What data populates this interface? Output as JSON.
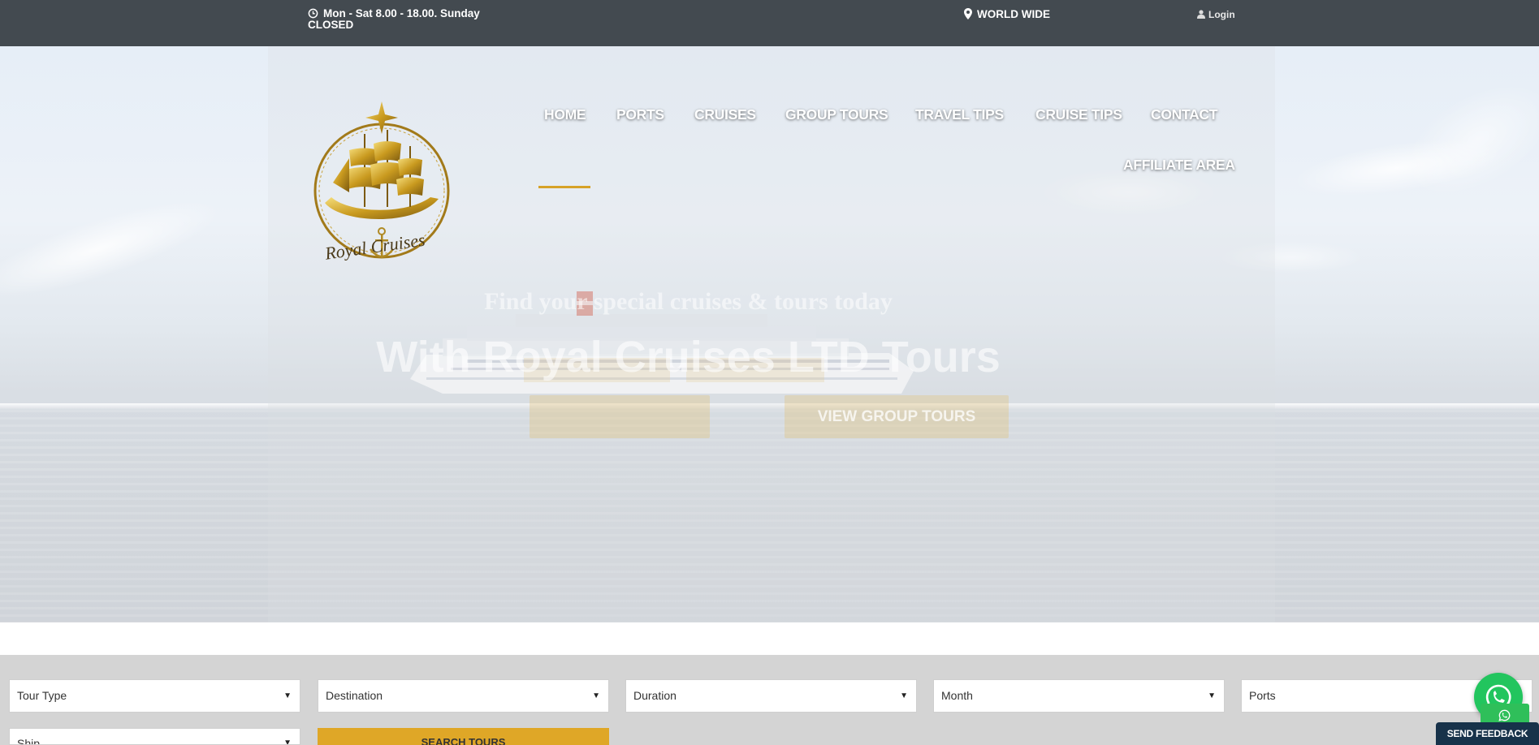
{
  "topbar": {
    "hours": "Mon - Sat 8.00 - 18.00. Sunday CLOSED",
    "location": "WORLD WIDE",
    "login": "Login"
  },
  "logo": {
    "text": "Royal Cruises"
  },
  "nav": {
    "items": [
      "HOME",
      "PORTS",
      "CRUISES",
      "GROUP TOURS",
      "TRAVEL TIPS",
      "CRUISE TIPS",
      "CONTACT",
      "AFFILIATE AREA"
    ],
    "active": "HOME"
  },
  "hero": {
    "subtitle": "Find your special cruises & tours today",
    "title": "With Royal Cruises LTD Tours",
    "button_1": "",
    "button_2": "VIEW GROUP TOURS"
  },
  "search": {
    "tour_type": "Tour Type",
    "destination": "Destination",
    "duration": "Duration",
    "month": "Month",
    "ports": "Ports",
    "ship": "Ship",
    "button": "SEARCH TOURS"
  },
  "widgets": {
    "feedback": "SEND FEEDBACK"
  },
  "colors": {
    "topbar": "#434a50",
    "accent": "#dfa727",
    "searchbar": "#d4d4d4",
    "whatsapp": "#22c55e",
    "feedback": "#17324a"
  },
  "icons": {
    "hours": "clock-icon",
    "location": "map-marker-icon",
    "login": "user-icon",
    "chat": "whatsapp-icon"
  }
}
